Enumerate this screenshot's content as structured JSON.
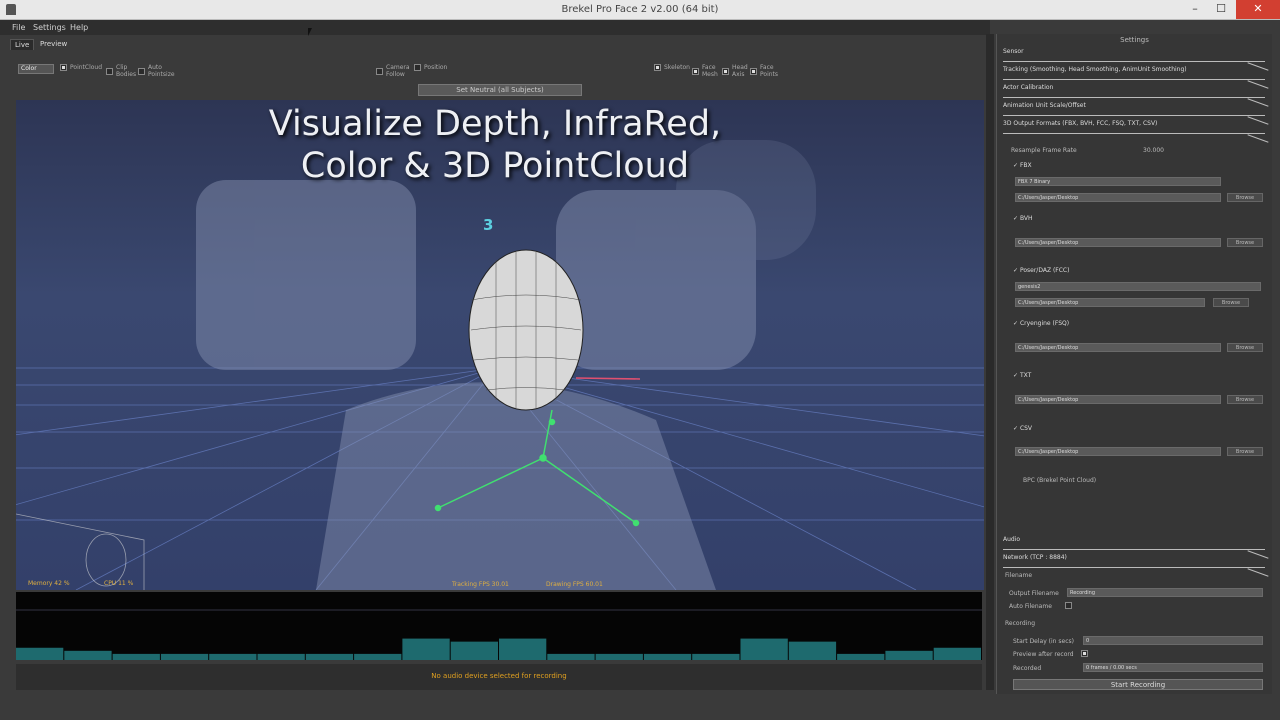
{
  "window": {
    "title": "Brekel Pro Face 2 v2.00 (64 bit)",
    "min": "–",
    "max": "☐",
    "close": "✕"
  },
  "menu": [
    "File",
    "Settings",
    "Help"
  ],
  "tabs": [
    "Live",
    "Preview"
  ],
  "toolbar": {
    "view_select": "Color",
    "items": [
      {
        "label": "PointCloud",
        "checked": true
      },
      {
        "label": "Clip Bodies",
        "checked": false
      },
      {
        "label": "Auto Pointsize",
        "checked": false
      },
      {
        "label": "Camera Follow",
        "checked": false
      },
      {
        "label": "Position",
        "checked": false
      },
      {
        "label": "Skeleton",
        "checked": true
      },
      {
        "label": "Face Mesh",
        "checked": true
      },
      {
        "label": "Head Axis",
        "checked": true
      },
      {
        "label": "Face Points",
        "checked": true
      }
    ],
    "neutral_button": "Set Neutral (all Subjects)"
  },
  "viewport": {
    "title_line1": "Visualize Depth, InfraRed,",
    "title_line2": "Color & 3D PointCloud",
    "subject_number": "3",
    "stats": {
      "memory": "Memory  42 %",
      "cpu": "CPU  11 %",
      "tracking": "Tracking FPS 30.01",
      "drawing": "Drawing FPS 60.01"
    }
  },
  "timeline": {
    "levels": [
      0.2,
      0.15,
      0.1,
      0.1,
      0.1,
      0.1,
      0.1,
      0.1,
      0.35,
      0.3,
      0.35,
      0.1,
      0.1,
      0.1,
      0.1,
      0.35,
      0.3,
      0.1,
      0.15,
      0.2
    ]
  },
  "audio": {
    "status": "No audio device selected for recording"
  },
  "settings": {
    "title": "Settings",
    "sections": [
      "Sensor",
      "Tracking (Smoothing, Head Smoothing, AnimUnit Smoothing)",
      "Actor Calibration",
      "Animation Unit Scale/Offset",
      "3D Output Formats (FBX, BVH, FCC, FSQ, TXT, CSV)"
    ],
    "resample_label": "Resample Frame Rate",
    "resample_value": "30.000",
    "formats": [
      {
        "label": "FBX",
        "select": "FBX 7 Binary",
        "path": "C:/Users/Jasper/Desktop",
        "browse": "Browse"
      },
      {
        "label": "BVH",
        "path": "C:/Users/Jasper/Desktop",
        "browse": "Browse"
      },
      {
        "label": "Poser/DAZ (FCC)",
        "select": "genesis2",
        "path": "C:/Users/Jasper/Desktop",
        "browse": "Browse"
      },
      {
        "label": "Cryengine (FSQ)",
        "path": "C:/Users/Jasper/Desktop",
        "browse": "Browse"
      },
      {
        "label": "TXT",
        "path": "C:/Users/Jasper/Desktop",
        "browse": "Browse"
      },
      {
        "label": "CSV",
        "path": "C:/Users/Jasper/Desktop",
        "browse": "Browse"
      }
    ],
    "bpc_label": "BPC (Brekel Point Cloud)",
    "audio_section": "Audio",
    "network_section": "Network (TCP : 8884)",
    "filename_label": "Filename",
    "output_filename_label": "Output Filename",
    "output_filename_value": "Recording",
    "auto_filename_label": "Auto Filename",
    "recording_label": "Recording",
    "start_delay_label": "Start Delay (in secs)",
    "start_delay_value": "0",
    "preview_after_label": "Preview after record",
    "recorded_label": "Recorded",
    "recorded_value": "0 frames / 0.00 secs",
    "start_button": "Start Recording"
  },
  "colors": {
    "accent": "#5cd0e0",
    "grid": "#6a82c8",
    "skeleton": "#40e070",
    "warn": "#e0a020"
  }
}
